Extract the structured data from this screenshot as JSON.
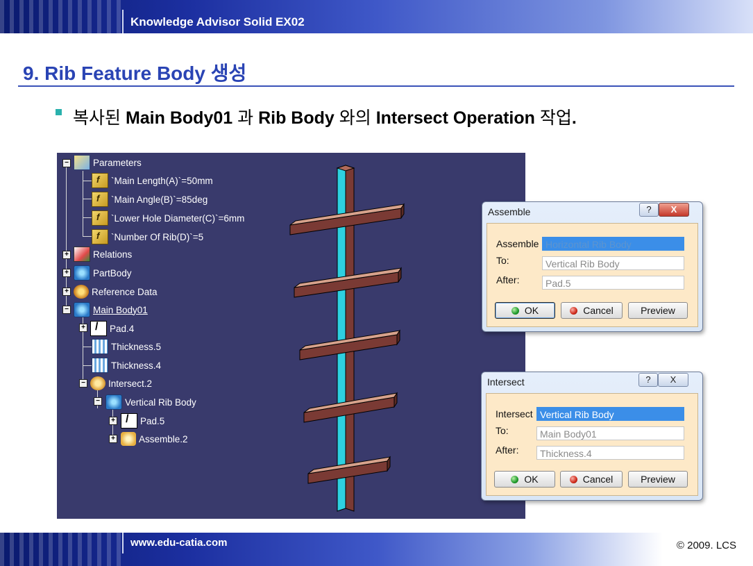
{
  "header": {
    "title": "Knowledge Advisor Solid EX02"
  },
  "slide": {
    "title": "9. Rib Feature Body 생성",
    "bullet": {
      "p1": "복사된 ",
      "b1": "Main Body01",
      "p2": " 과 ",
      "b2": "Rib Body",
      "p3": " 와의 ",
      "b3": "Intersect Operation",
      "p4": " 작업",
      "b4": "."
    }
  },
  "tree": {
    "parameters": "Parameters",
    "main_length": "`Main Length(A)`=50mm",
    "main_angle": "`Main Angle(B)`=85deg",
    "lower_hole": "`Lower Hole Diameter(C)`=6mm",
    "num_rib": "`Number Of Rib(D)`=5",
    "relations": "Relations",
    "partbody": "PartBody",
    "reference": "Reference Data",
    "main_body": "Main Body01",
    "pad4": "Pad.4",
    "thick5": "Thickness.5",
    "thick4": "Thickness.4",
    "intersect2": "Intersect.2",
    "vertical_rib": "Vertical Rib Body",
    "pad5": "Pad.5",
    "assemble2": "Assemble.2"
  },
  "assemble_dialog": {
    "title": "Assemble",
    "help": "?",
    "close": "X",
    "label_assemble": "Assemble",
    "value_assemble": "Horizontal Rib Body",
    "label_to": "To:",
    "value_to": "Vertical Rib Body",
    "label_after": "After:",
    "value_after": "Pad.5",
    "ok": "OK",
    "cancel": "Cancel",
    "preview": "Preview"
  },
  "intersect_dialog": {
    "title": "Intersect",
    "help": "?",
    "close": "X",
    "label_intersect": "Intersect",
    "value_intersect": "Vertical Rib Body",
    "label_to": "To:",
    "value_to": "Main Body01",
    "label_after": "After:",
    "value_after": "Thickness.4",
    "ok": "OK",
    "cancel": "Cancel",
    "preview": "Preview"
  },
  "footer": {
    "url": "www.edu-catia.com",
    "copyright": "© 2009. LCS"
  },
  "colors": {
    "title_blue": "#2a44b4",
    "viewport_bg": "#393a6c",
    "rib_color": "#7a3a34",
    "shaft_cyan": "#2ed0e0",
    "bullet_teal": "#2ab1ad"
  }
}
